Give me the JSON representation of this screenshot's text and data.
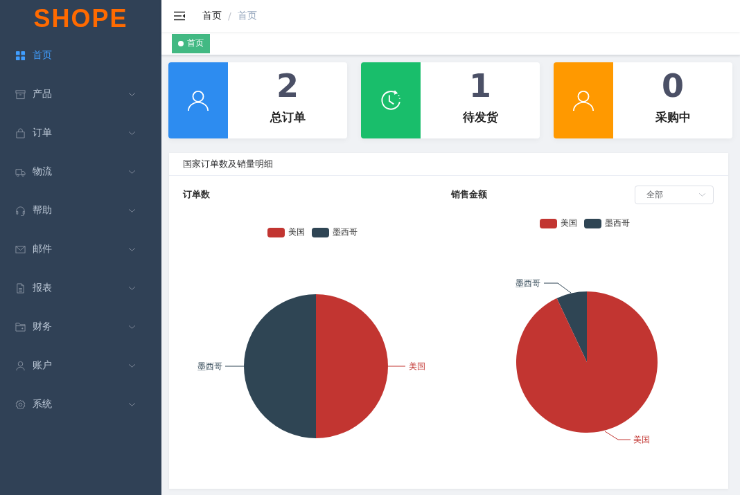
{
  "logo": "SHOPE",
  "sidebar": {
    "items": [
      {
        "label": "首页",
        "selected": true,
        "kind": "link"
      },
      {
        "label": "产品",
        "selected": false,
        "kind": "submenu"
      },
      {
        "label": "订单",
        "selected": false,
        "kind": "submenu"
      },
      {
        "label": "物流",
        "selected": false,
        "kind": "submenu"
      },
      {
        "label": "帮助",
        "selected": false,
        "kind": "submenu"
      },
      {
        "label": "邮件",
        "selected": false,
        "kind": "submenu"
      },
      {
        "label": "报表",
        "selected": false,
        "kind": "submenu"
      },
      {
        "label": "财务",
        "selected": false,
        "kind": "submenu"
      },
      {
        "label": "账户",
        "selected": false,
        "kind": "submenu"
      },
      {
        "label": "系统",
        "selected": false,
        "kind": "submenu"
      }
    ]
  },
  "breadcrumb": {
    "separator": "/",
    "items": [
      "首页",
      "首页"
    ]
  },
  "tags": [
    {
      "label": "首页",
      "selected": true
    }
  ],
  "stats": [
    {
      "value": "2",
      "label": "总订单",
      "color": "#2d8cf0",
      "kind": "user"
    },
    {
      "value": "1",
      "label": "待发货",
      "color": "#19be6b",
      "kind": "clock"
    },
    {
      "value": "0",
      "label": "采购中",
      "color": "#ff9900",
      "kind": "user"
    }
  ],
  "panel": {
    "title": "国家订单数及销量明细",
    "charts": [
      {
        "title": "订单数",
        "legend": [
          {
            "label": "美国",
            "color": "#c23531"
          },
          {
            "label": "墨西哥",
            "color": "#2f4554"
          }
        ],
        "slices": [
          {
            "label": "墨西哥",
            "color": "#2f4554"
          },
          {
            "label": "美国",
            "color": "#c23531"
          }
        ]
      },
      {
        "title": "销售金额",
        "select": {
          "value": "全部"
        },
        "legend": [
          {
            "label": "美国",
            "color": "#c23531"
          },
          {
            "label": "墨西哥",
            "color": "#2f4554"
          }
        ],
        "slices": [
          {
            "label": "墨西哥",
            "color": "#2f4554"
          },
          {
            "label": "美国",
            "color": "#c23531"
          }
        ]
      }
    ]
  }
}
